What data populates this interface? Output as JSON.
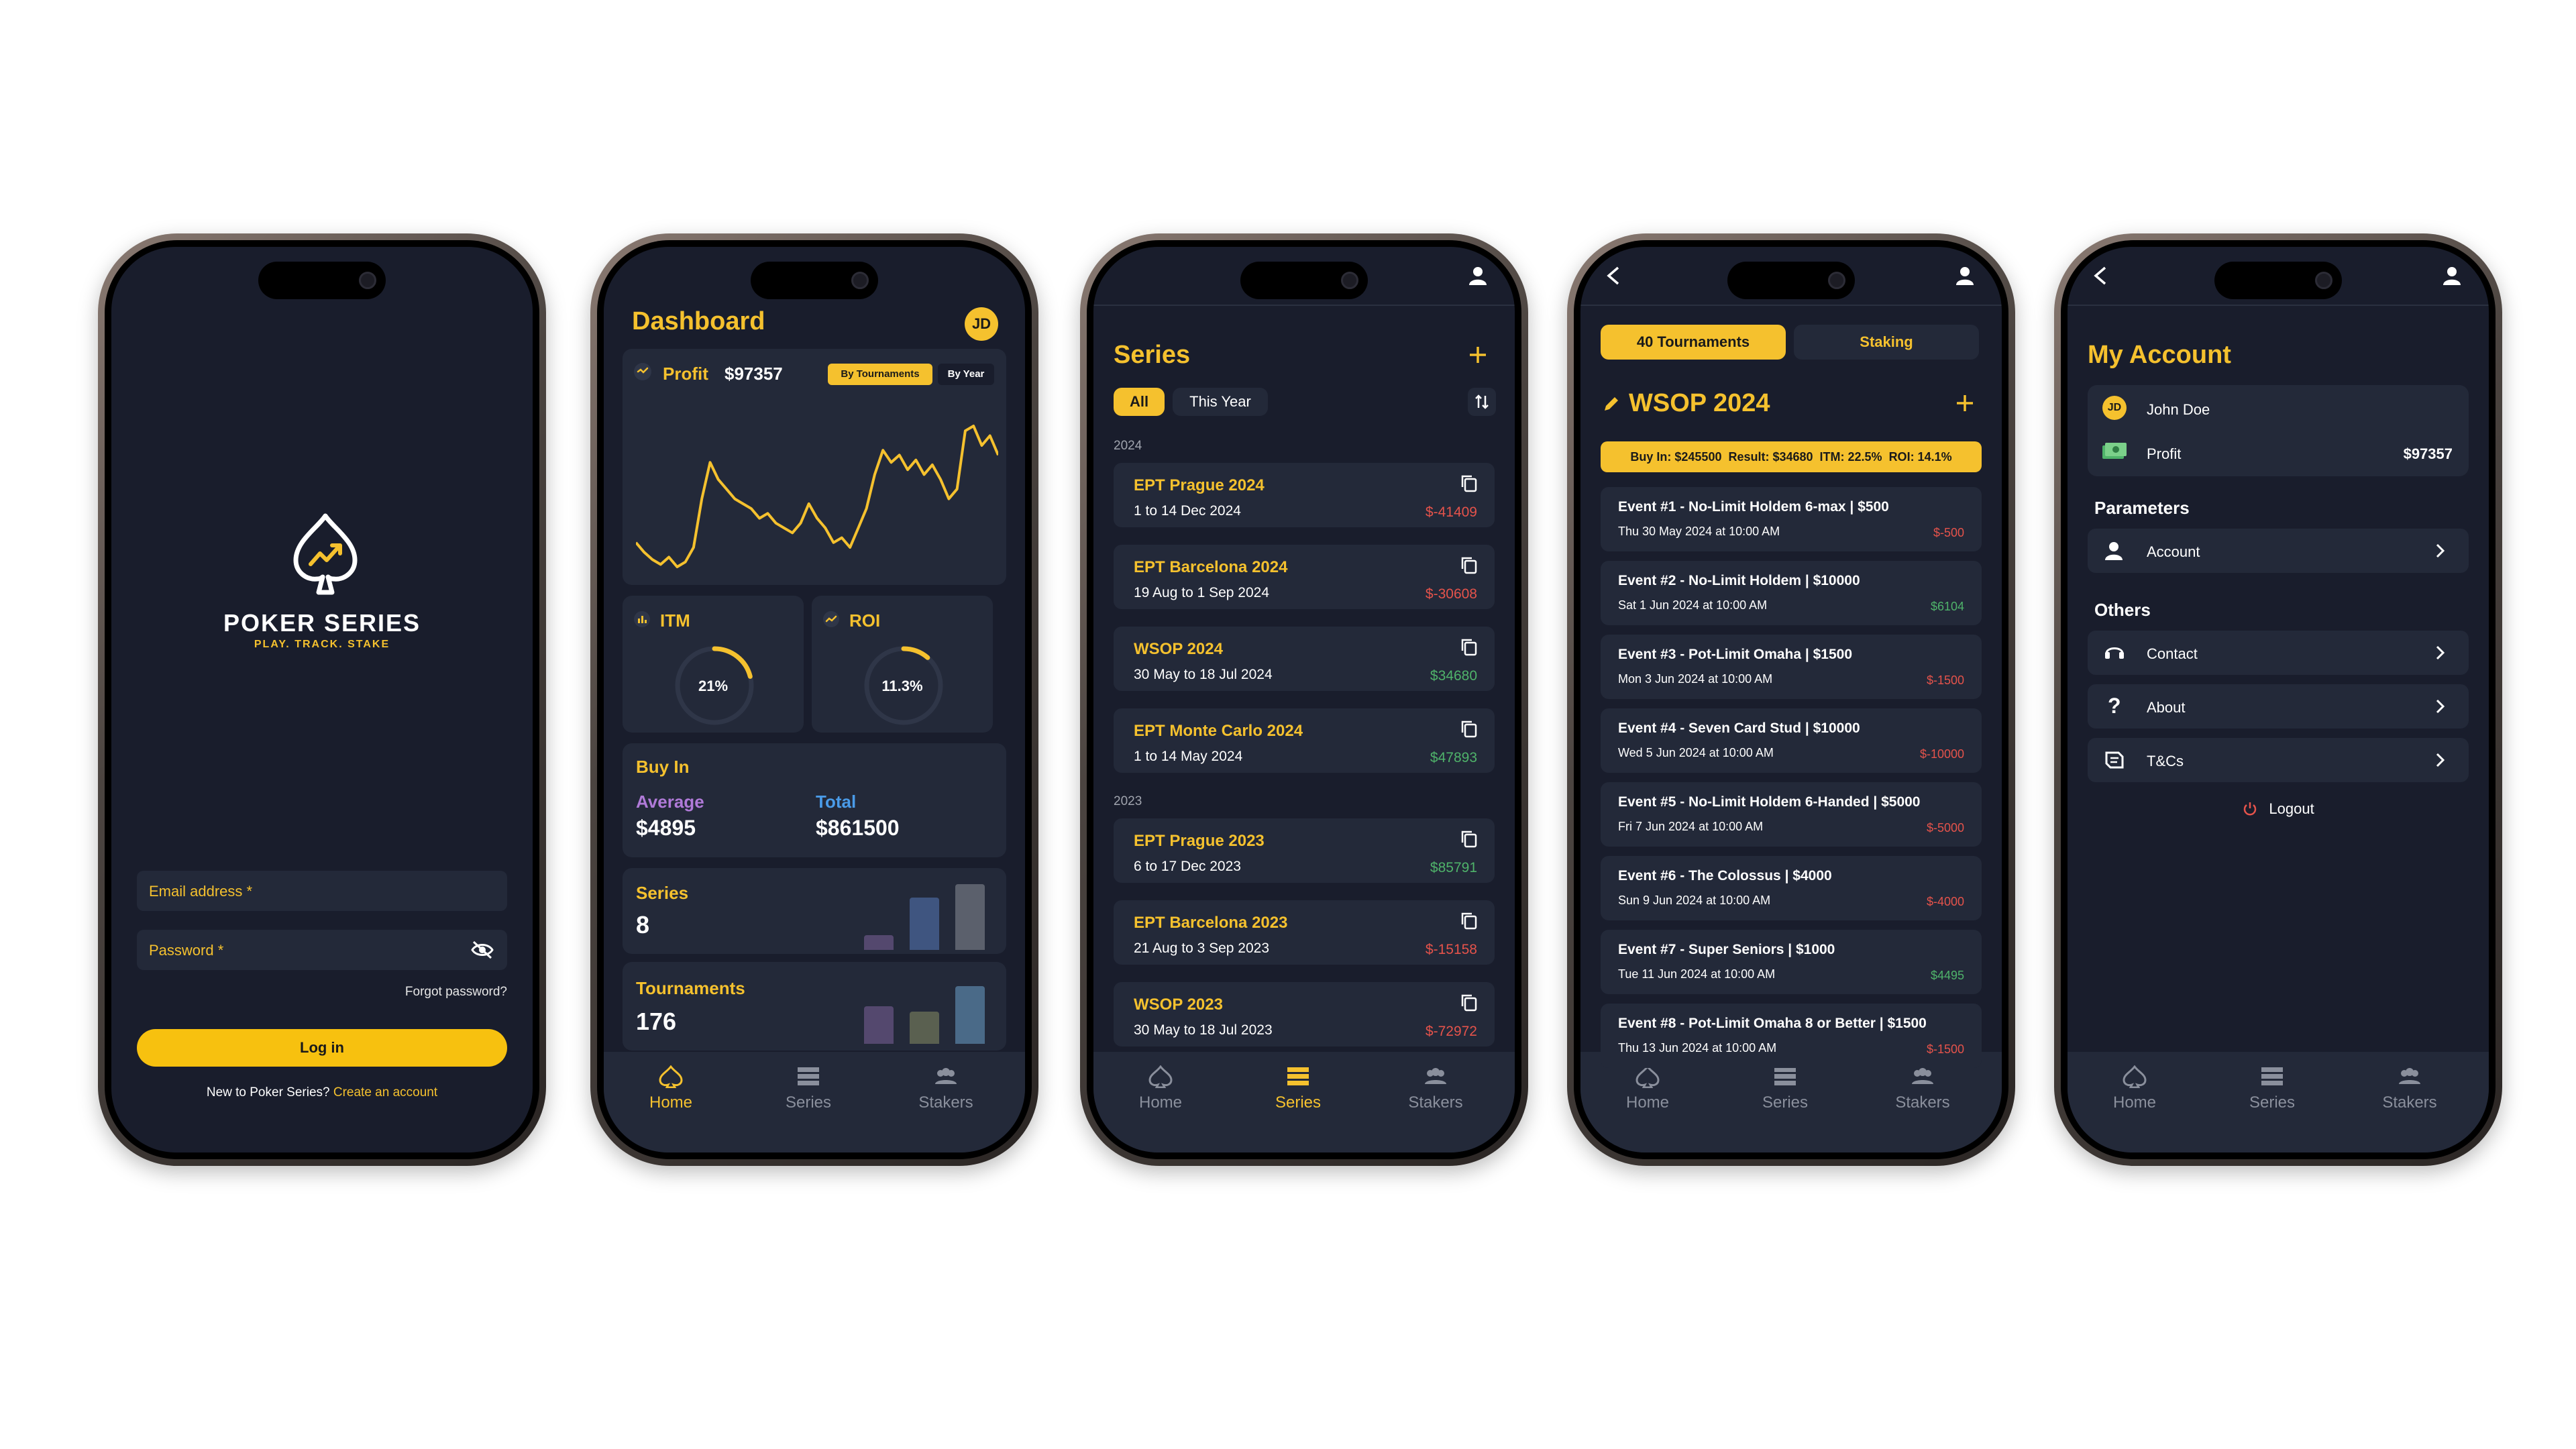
{
  "login": {
    "brand_title": "POKER SERIES",
    "brand_tagline": "PLAY. TRACK. STAKE",
    "email_placeholder": "Email address *",
    "password_placeholder": "Password *",
    "forgot_label": "Forgot password?",
    "login_label": "Log in",
    "signup_prompt": "New to Poker Series?",
    "signup_link": "Create an account"
  },
  "dashboard": {
    "title": "Dashboard",
    "avatar_initials": "JD",
    "profit_label": "Profit",
    "profit_value": "$97357",
    "toggle_tournaments": "By Tournaments",
    "toggle_year": "By Year",
    "itm_label": "ITM",
    "itm_value": "21%",
    "itm_fraction": 0.21,
    "roi_label": "ROI",
    "roi_value": "11.3%",
    "roi_fraction": 0.113,
    "buyin_label": "Buy In",
    "average_label": "Average",
    "average_value": "$4895",
    "total_label": "Total",
    "total_value": "$861500",
    "series_label": "Series",
    "series_value": "8",
    "tournaments_label": "Tournaments",
    "tournaments_value": "176"
  },
  "chart_data": {
    "type": "line",
    "title": "",
    "xlabel": "",
    "ylabel": "",
    "grid": false,
    "series": [
      {
        "values": [
          12,
          8,
          5,
          3,
          6,
          2,
          4,
          10,
          30,
          45,
          38,
          34,
          30,
          28,
          26,
          22,
          24,
          20,
          18,
          16,
          20,
          28,
          22,
          18,
          12,
          14,
          10,
          18,
          26,
          40,
          50,
          45,
          48,
          42,
          46,
          40,
          44,
          38,
          30,
          34,
          58,
          60,
          52,
          56,
          48
        ]
      }
    ]
  },
  "series_screen": {
    "title": "Series",
    "filter_all": "All",
    "filter_year": "This Year",
    "groups": [
      {
        "year": "2024",
        "items": [
          {
            "name": "EPT Prague 2024",
            "dates": "1 to 14 Dec 2024",
            "result": "$-41409",
            "positive": false
          },
          {
            "name": "EPT Barcelona 2024",
            "dates": "19 Aug to 1 Sep 2024",
            "result": "$-30608",
            "positive": false
          },
          {
            "name": "WSOP 2024",
            "dates": "30 May to 18 Jul 2024",
            "result": "$34680",
            "positive": true
          },
          {
            "name": "EPT Monte Carlo 2024",
            "dates": "1 to 14 May 2024",
            "result": "$47893",
            "positive": true
          }
        ]
      },
      {
        "year": "2023",
        "items": [
          {
            "name": "EPT Prague 2023",
            "dates": "6 to 17 Dec 2023",
            "result": "$85791",
            "positive": true
          },
          {
            "name": "EPT Barcelona 2023",
            "dates": "21 Aug to 3 Sep 2023",
            "result": "$-15158",
            "positive": false
          },
          {
            "name": "WSOP 2023",
            "dates": "30 May to 18 Jul 2023",
            "result": "$-72972",
            "positive": false
          }
        ]
      }
    ]
  },
  "wsop": {
    "tab_tournaments": "40 Tournaments",
    "tab_staking": "Staking",
    "title": "WSOP 2024",
    "summary": "Buy In: $245500  Result: $34680  ITM: 22.5%  ROI: 14.1%",
    "events": [
      {
        "name": "Event #1 - No-Limit Holdem 6-max | $500",
        "date": "Thu 30 May 2024 at 10:00 AM",
        "result": "$-500",
        "positive": false
      },
      {
        "name": "Event #2 - No-Limit Holdem | $10000",
        "date": "Sat 1 Jun 2024 at 10:00 AM",
        "result": "$6104",
        "positive": true
      },
      {
        "name": "Event #3 - Pot-Limit Omaha | $1500",
        "date": "Mon 3 Jun 2024 at 10:00 AM",
        "result": "$-1500",
        "positive": false
      },
      {
        "name": "Event #4 - Seven Card Stud | $10000",
        "date": "Wed 5 Jun 2024 at 10:00 AM",
        "result": "$-10000",
        "positive": false
      },
      {
        "name": "Event #5 - No-Limit Holdem 6-Handed | $5000",
        "date": "Fri 7 Jun 2024 at 10:00 AM",
        "result": "$-5000",
        "positive": false
      },
      {
        "name": "Event #6 - The Colossus | $4000",
        "date": "Sun 9 Jun 2024 at 10:00 AM",
        "result": "$-4000",
        "positive": false
      },
      {
        "name": "Event #7 - Super Seniors | $1000",
        "date": "Tue 11 Jun 2024 at 10:00 AM",
        "result": "$4495",
        "positive": true
      },
      {
        "name": "Event #8 - Pot-Limit Omaha 8 or Better | $1500",
        "date": "Thu 13 Jun 2024 at 10:00 AM",
        "result": "$-1500",
        "positive": false
      }
    ]
  },
  "account": {
    "title": "My Account",
    "avatar_initials": "JD",
    "user_name": "John Doe",
    "profit_label": "Profit",
    "profit_value": "$97357",
    "parameters_label": "Parameters",
    "account_item": "Account",
    "others_label": "Others",
    "contact_item": "Contact",
    "about_item": "About",
    "tcs_item": "T&Cs",
    "logout_label": "Logout"
  },
  "nav": {
    "home": "Home",
    "series": "Series",
    "stakers": "Stakers"
  },
  "colors": {
    "accent": "#f5c12e",
    "background": "#191d2c",
    "card": "#232939",
    "negative": "#e5534b",
    "positive": "#4fb36a",
    "average": "#b07ad8",
    "total": "#4a9be8"
  },
  "icons": [
    "spade-logo-icon",
    "eye-off-icon",
    "avatar-icon",
    "trend-icon",
    "bar-chart-icon",
    "copy-icon",
    "plus-icon",
    "sort-icon",
    "person-icon",
    "back-arrow-icon",
    "pencil-icon",
    "chevron-right-icon",
    "money-icon",
    "contact-icon",
    "question-icon",
    "document-icon",
    "power-icon",
    "home-icon",
    "series-icon",
    "stakers-icon"
  ]
}
